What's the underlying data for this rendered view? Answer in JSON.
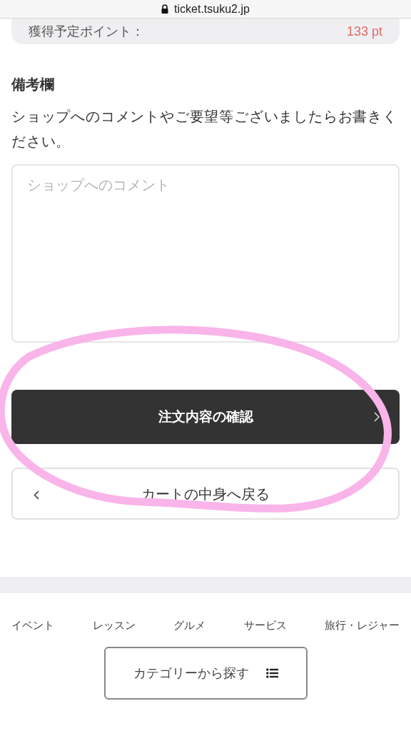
{
  "browser": {
    "url": "ticket.tsuku2.jp"
  },
  "points": {
    "label": "獲得予定ポイント：",
    "value": "133 pt"
  },
  "remarks": {
    "heading": "備考欄",
    "description": "ショップへのコメントやご要望等ございましたらお書きください。",
    "placeholder": "ショップへのコメント"
  },
  "buttons": [
    {
      "kind": "primary",
      "label": "注文内容の確認"
    },
    {
      "kind": "back",
      "label": "カートの中身へ戻る"
    }
  ],
  "annotation": {
    "kind": "circle"
  },
  "footer": {
    "categories": [
      "イベント",
      "レッスン",
      "グルメ",
      "サービス",
      "旅行・レジャー"
    ],
    "category_button": "カテゴリーから探す"
  }
}
